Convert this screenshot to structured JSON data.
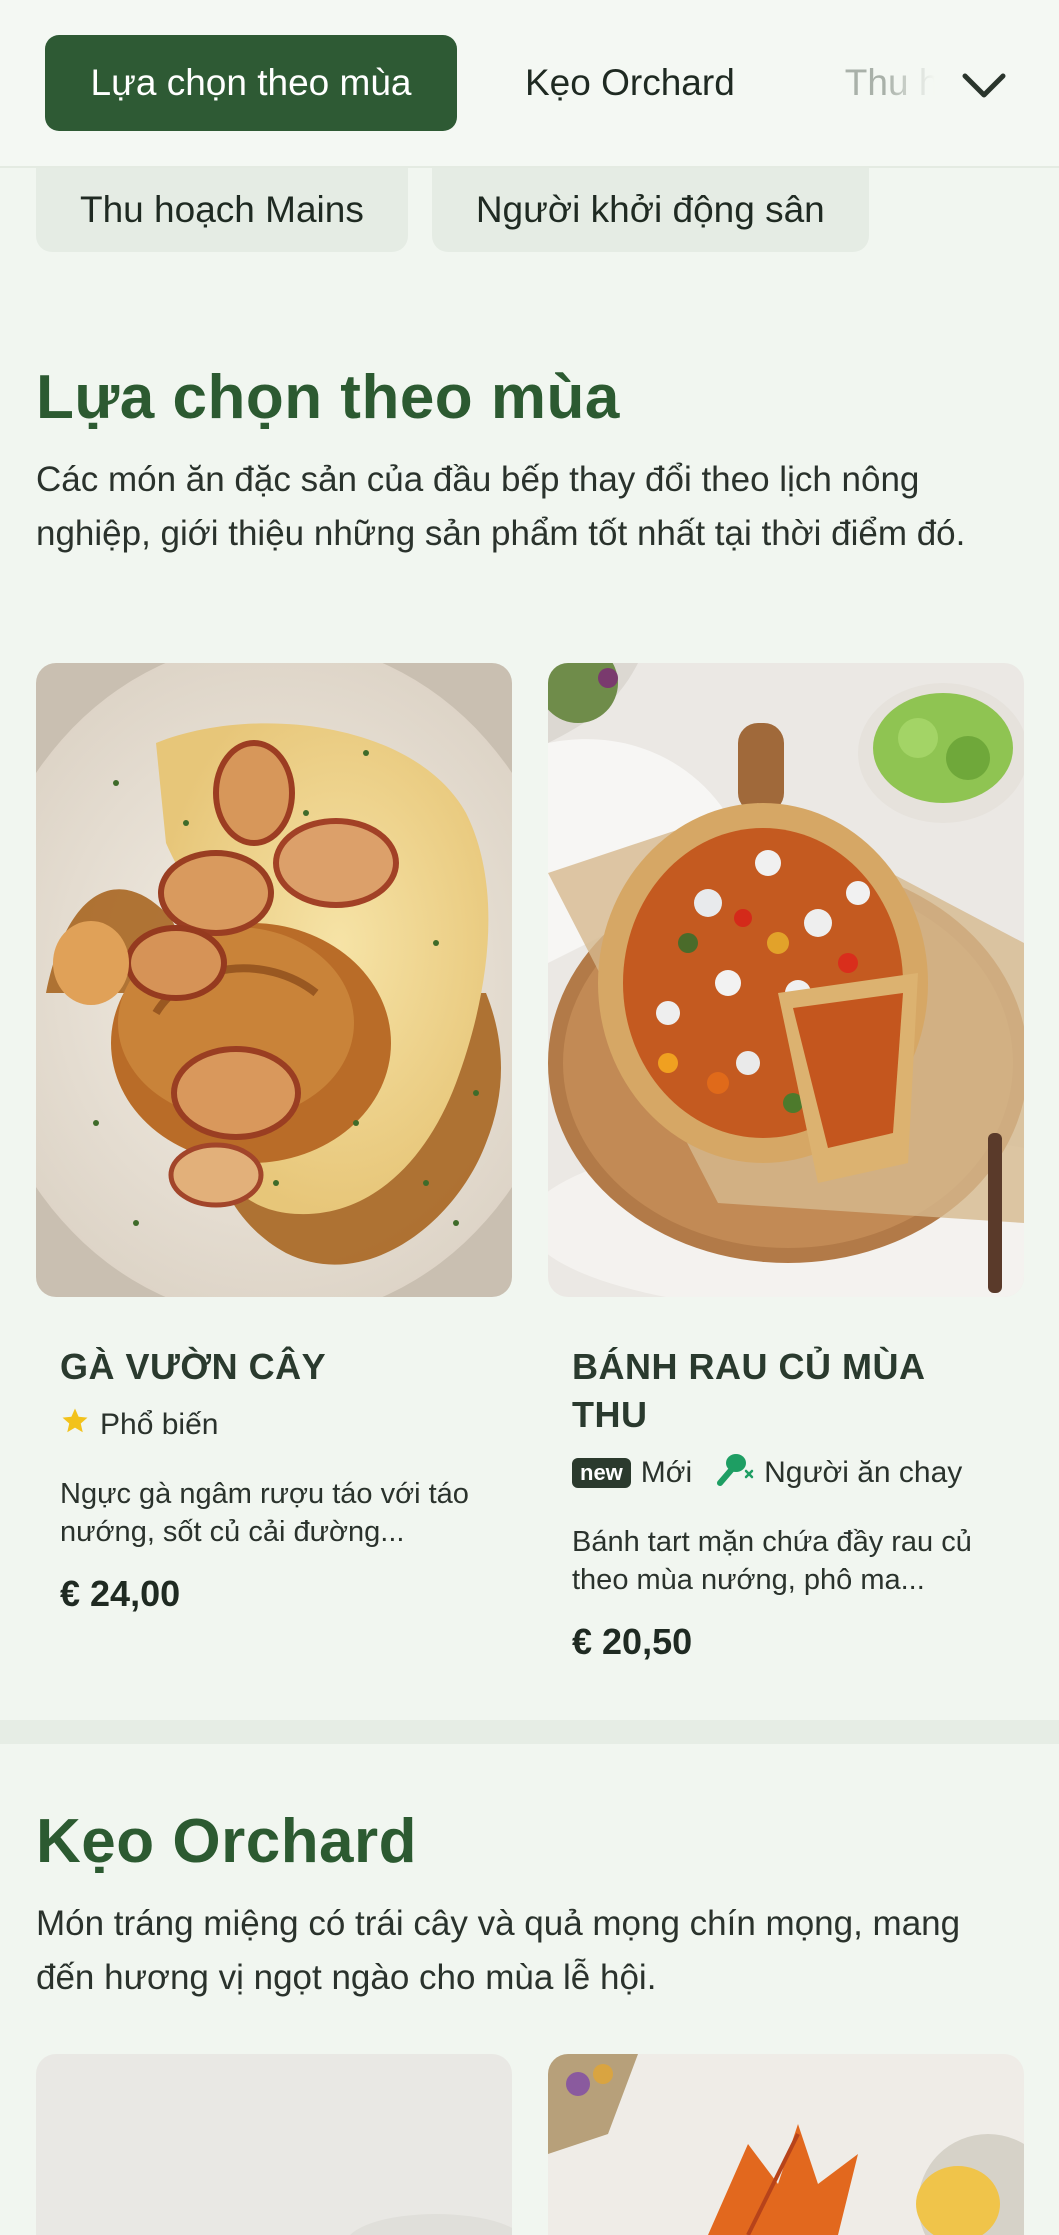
{
  "tabs": {
    "active": "Lựa chọn theo mùa",
    "second": "Kẹo Orchard",
    "third": "Thu h"
  },
  "chips": [
    "Thu hoạch Mains",
    "Người khởi động sân"
  ],
  "section1": {
    "title": "Lựa chọn theo mùa",
    "desc": "Các món ăn đặc sản của đầu bếp thay đổi theo lịch nông nghiệp, giới thiệu những sản phẩm tốt nhất tại thời điểm đó.",
    "items": [
      {
        "title": "GÀ VƯỜN CÂY",
        "tag_popular": "Phổ biến",
        "desc": "Ngực gà ngâm rượu táo với táo nướng, sốt củ cải đường...",
        "price": "€ 24,00"
      },
      {
        "title": "BÁNH RAU CỦ MÙA THU",
        "badge_new": "new",
        "tag_new": "Mới",
        "tag_veg": "Người ăn chay",
        "desc": "Bánh tart mặn chứa đầy rau củ theo mùa nướng, phô ma...",
        "price": "€ 20,50"
      }
    ]
  },
  "section2": {
    "title": "Kẹo Orchard",
    "desc": "Món tráng miệng có trái cây và quả mọng chín mọng, mang đến hương vị ngọt ngào cho mùa lễ hội."
  },
  "colors": {
    "brand": "#2e5a34",
    "title": "#2c5a31",
    "background": "#f1f6f0",
    "star": "#f2c21b",
    "veg": "#1e9e63"
  },
  "icons": [
    "chevron-down-icon",
    "star-icon",
    "vegetarian-icon"
  ]
}
